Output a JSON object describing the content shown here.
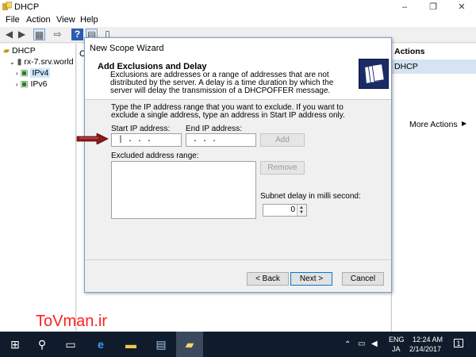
{
  "window": {
    "title": "DHCP",
    "minimize": "–",
    "restore": "❐",
    "close": "✕"
  },
  "menu": {
    "file": "File",
    "action": "Action",
    "view": "View",
    "help": "Help"
  },
  "toolbar": {
    "back_icon": "arrow-left",
    "forward_icon": "arrow-right",
    "help_icon": "help"
  },
  "tree": {
    "root": "DHCP",
    "server": "rx-7.srv.world",
    "ipv4": "IPv4",
    "ipv6": "IPv6"
  },
  "center": {
    "clipped_label": "C"
  },
  "actions": {
    "header": "Actions",
    "section": "DHCP",
    "more": "More Actions",
    "more_arrow": "▶"
  },
  "wizard": {
    "title": "New Scope Wizard",
    "heading": "Add Exclusions and Delay",
    "description": "Exclusions are addresses or a range of addresses that are not distributed by the server. A delay is a time duration by which the server will delay the transmission of a DHCPOFFER message.",
    "instructions": "Type the IP address range that you want to exclude. If you want to exclude a single address, type an address in Start IP address only.",
    "start_ip_label": "Start IP address:",
    "end_ip_label": "End IP address:",
    "start_ip_value": "|    .    .    .",
    "end_ip_value": "     .    .    .",
    "add_button": "Add",
    "excluded_label": "Excluded address range:",
    "remove_button": "Remove",
    "delay_label": "Subnet delay in milli second:",
    "delay_value": "0",
    "back_button": "< Back",
    "next_button": "Next >",
    "cancel_button": "Cancel"
  },
  "watermark": "ToVman.ir",
  "tray": {
    "lang1": "ENG",
    "lang2": "JA",
    "time": "12:24 AM",
    "date": "2/14/2017",
    "notifications": "1"
  }
}
